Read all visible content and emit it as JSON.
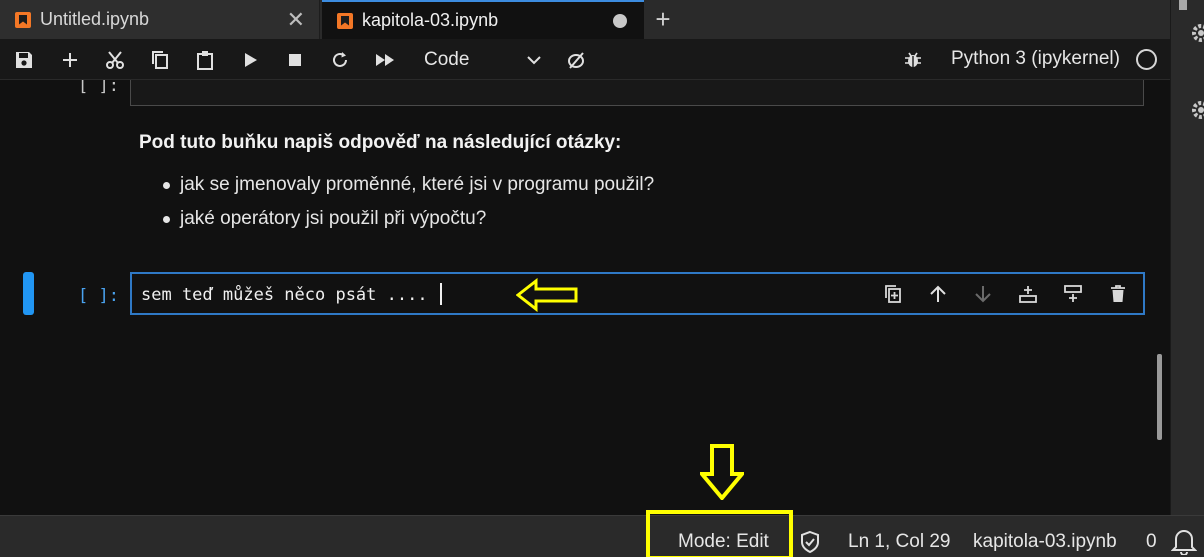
{
  "tabs": [
    {
      "label": "Untitled.ipynb",
      "icon": "notebook-icon",
      "action": "close-icon"
    },
    {
      "label": "kapitola-03.ipynb",
      "icon": "notebook-icon",
      "action": "unsaved-dot-icon",
      "active": true
    }
  ],
  "new_tab_icon": "plus-icon",
  "toolbar": {
    "buttons": [
      "save-icon",
      "insert-cell-icon",
      "cut-icon",
      "copy-icon",
      "paste-icon",
      "run-icon",
      "stop-icon",
      "restart-icon",
      "run-all-icon"
    ],
    "cell_type": "Code",
    "kernel_name": "Python 3 (ipykernel)"
  },
  "notebook": {
    "prev_prompt": "[ ]:",
    "markdown": {
      "heading": "Pod tuto buňku napiš odpověď na následující otázky:",
      "items": [
        "jak se jmenovaly proměnné, které jsi v programu použil?",
        "jaké operátory jsi použil při výpočtu?"
      ]
    },
    "code_cell": {
      "prompt": "[ ]:",
      "text": "sem teď můžeš něco psát ...."
    }
  },
  "statusbar": {
    "mode": "Mode: Edit",
    "position": "Ln 1, Col 29",
    "filename": "kapitola-03.ipynb",
    "notifications": "0"
  },
  "colors": {
    "accent": "#2196f3",
    "highlight": "#ffff00",
    "notebook_icon": "#f37726"
  }
}
